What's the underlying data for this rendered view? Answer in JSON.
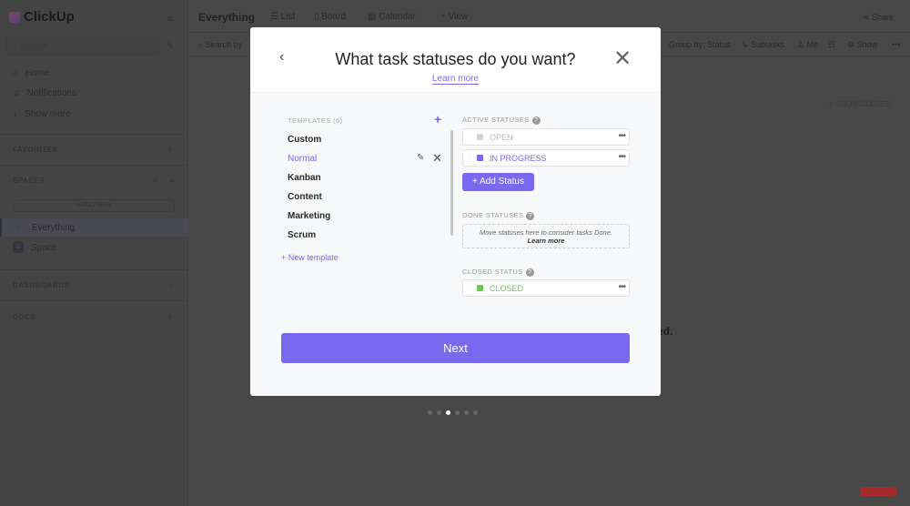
{
  "sidebar": {
    "brand": "ClickUp",
    "search_placeholder": "Search",
    "nav": [
      {
        "icon": "home-icon",
        "label": "Home"
      },
      {
        "icon": "bell-icon",
        "label": "Notifications"
      },
      {
        "icon": "arrow-down-icon",
        "label": "Show more"
      }
    ],
    "favorites": "FAVORITES",
    "spaces": "SPACES",
    "add_new": "+ ADD NEW",
    "everything": "Everything",
    "space": "Space",
    "space_initial": "S",
    "dashboards": "DASHBOARDS",
    "docs": "DOCS"
  },
  "header": {
    "title": "Everything",
    "tabs": [
      "List",
      "Board",
      "Calendar",
      "+ View"
    ],
    "share": "Share"
  },
  "toolbar": {
    "search_placeholder": "Search by",
    "group_by": "Group by: Status",
    "subtasks": "Subtasks",
    "me": "Me",
    "show": "Show",
    "more": "•••"
  },
  "background": {
    "show_closed": "SHOW CLOSED",
    "fragment": "ed."
  },
  "modal": {
    "title": "What task statuses do you want?",
    "learn_more": "Learn more",
    "templates_header": "TEMPLATES (6)",
    "templates": [
      "Custom",
      "Normal",
      "Kanban",
      "Content",
      "Marketing",
      "Scrum"
    ],
    "selected_template": "Normal",
    "new_template": "+ New template",
    "active_header": "ACTIVE STATUSES",
    "done_header": "DONE STATUSES",
    "closed_header": "CLOSED STATUS",
    "active_statuses": [
      {
        "label": "OPEN",
        "color": "#d3d3d3"
      },
      {
        "label": "IN PROGRESS",
        "color": "#7b68ee"
      }
    ],
    "add_status": "+ Add Status",
    "done_hint": "Move statuses here to consider tasks Done.",
    "done_learn": "Learn more",
    "closed_status": {
      "label": "CLOSED",
      "color": "#6bc950"
    },
    "next": "Next"
  },
  "pager": {
    "total": 6,
    "current": 3
  },
  "watermark": "Subscribe",
  "colors": {
    "accent": "#7b68ee",
    "overlay": "#484848"
  }
}
